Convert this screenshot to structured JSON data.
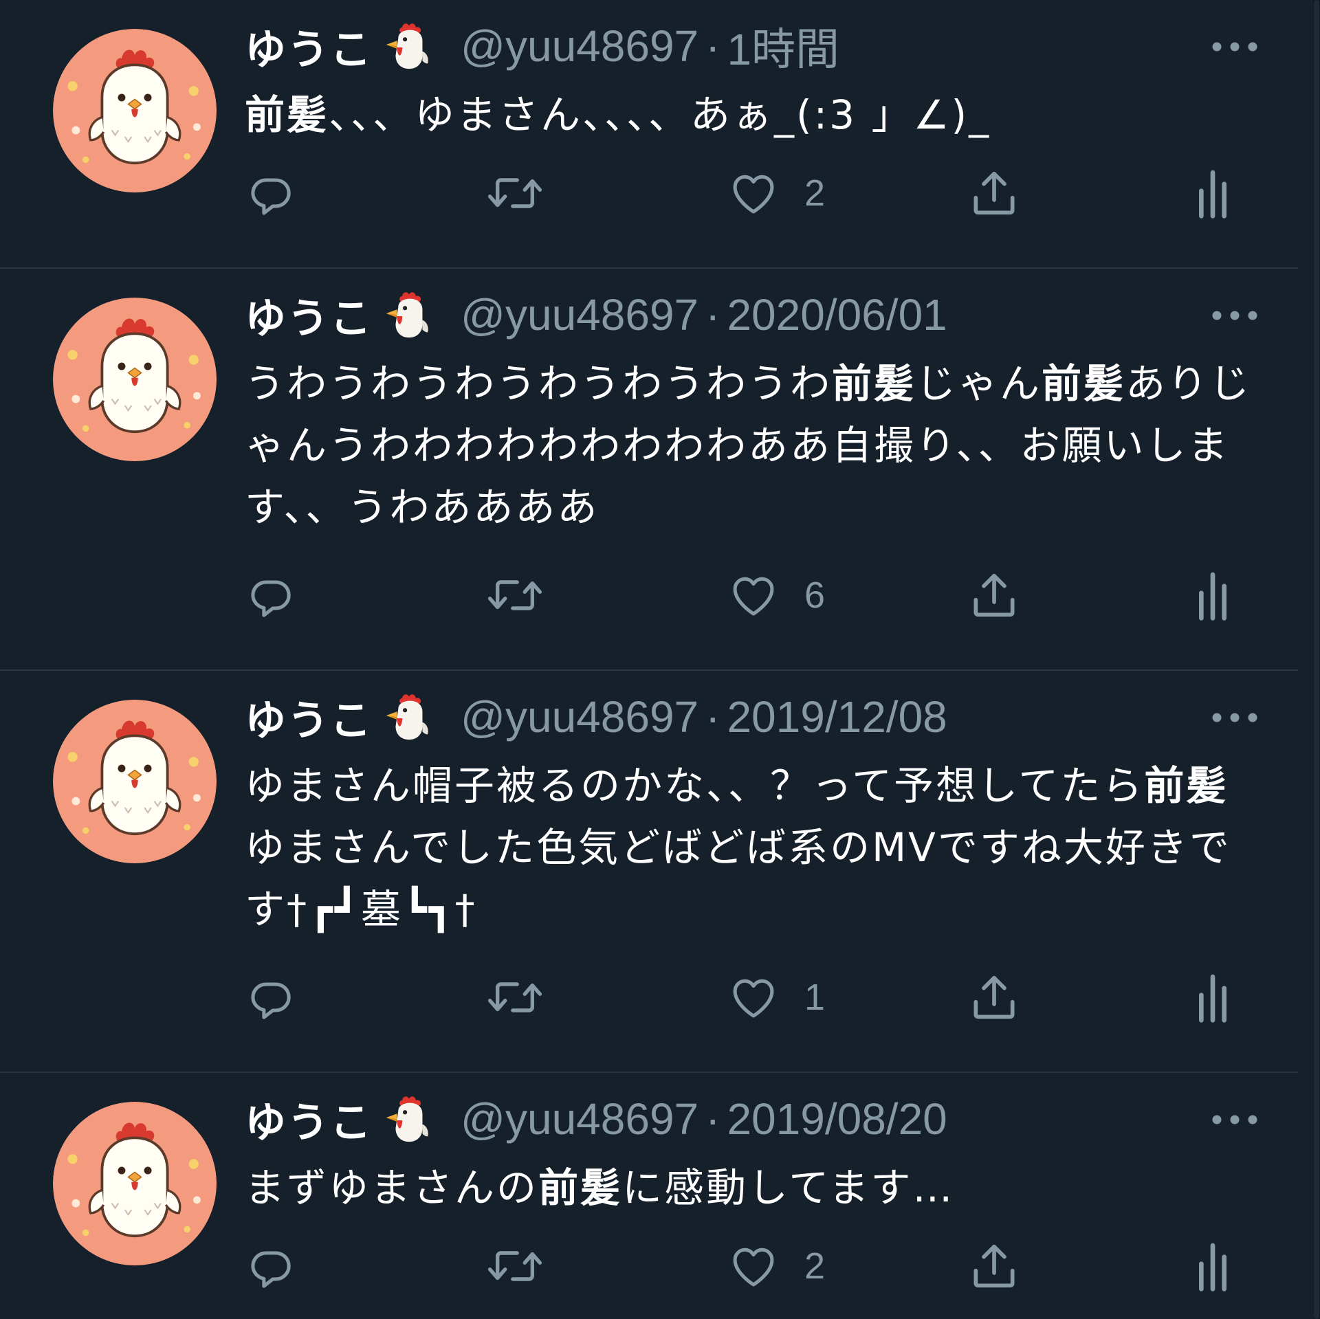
{
  "author": {
    "display_name": "ゆうこ",
    "name_emoji": "rooster-emoji",
    "handle": "@yuu48697",
    "avatar": "chick-avatar"
  },
  "separator": "·",
  "colors": {
    "background": "#15202b",
    "divider": "#2b3640",
    "secondary_text": "#8899a6",
    "primary_text": "#ffffff",
    "avatar_bg": "#f49a7e"
  },
  "tweets": [
    {
      "timestamp": "1時間",
      "segments": [
        {
          "text": "前髪",
          "bold": true
        },
        {
          "text": "、、、ゆまさん、、、、あぁ_(:3 」∠)_",
          "bold": false
        }
      ],
      "like_count": "2"
    },
    {
      "timestamp": "2020/06/01",
      "segments": [
        {
          "text": "うわうわうわうわうわうわうわ",
          "bold": false
        },
        {
          "text": "前髪",
          "bold": true
        },
        {
          "text": "じゃん",
          "bold": false
        },
        {
          "text": "前髪",
          "bold": true
        },
        {
          "text": "ありじゃんうわわわわわわわわわああ自撮り、、お願いします、、うわああああ",
          "bold": false
        }
      ],
      "like_count": "6"
    },
    {
      "timestamp": "2019/12/08",
      "segments": [
        {
          "text": "ゆまさん帽子被るのかな、、？って予想してたら",
          "bold": false
        },
        {
          "text": "前髪",
          "bold": true
        },
        {
          "text": "ゆまさんでした色気どばどば系のMVですね大好きです†┏┛墓┗┓†",
          "bold": false
        }
      ],
      "like_count": "1"
    },
    {
      "timestamp": "2019/08/20",
      "segments": [
        {
          "text": "まずゆまさんの",
          "bold": false
        },
        {
          "text": "前髪",
          "bold": true
        },
        {
          "text": "に感動してます…",
          "bold": false
        }
      ],
      "like_count": "2"
    }
  ],
  "icons": {
    "reply": "reply-icon",
    "retweet": "retweet-icon",
    "like": "heart-icon",
    "share": "share-icon",
    "analytics": "analytics-icon",
    "more": "more-icon"
  }
}
